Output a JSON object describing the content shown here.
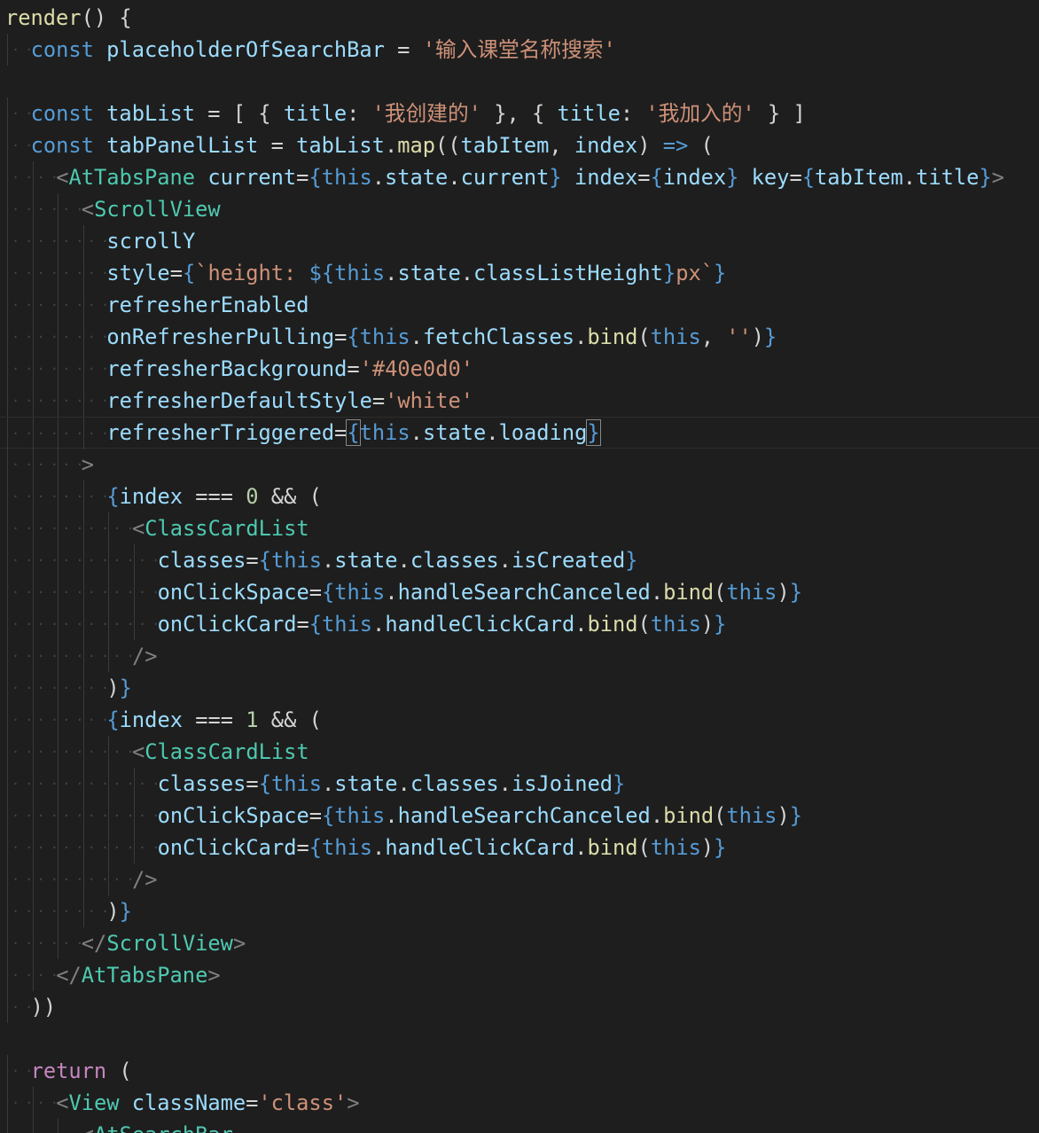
{
  "colors": {
    "background": "#1e1e1e",
    "keyword": "#569cd6",
    "variable": "#9cdcfe",
    "function": "#dcdcaa",
    "string": "#ce9178",
    "tag": "#4ec9b0",
    "number": "#b5cea8",
    "control": "#c586c0",
    "punctuation": "#d4d4d4",
    "tag_bracket": "#808080",
    "whitespace_marker": "#444444",
    "indent_guide": "#3a3a3a"
  },
  "lines": [
    {
      "indent": 0,
      "tokens": [
        [
          "render",
          "fn"
        ],
        [
          "() {",
          "p"
        ]
      ]
    },
    {
      "indent": 1,
      "tokens": [
        [
          "const",
          "kw"
        ],
        [
          " ",
          "p"
        ],
        [
          "placeholderOfSearchBar",
          "v"
        ],
        [
          " = ",
          "p"
        ],
        [
          "'输入课堂名称搜索'",
          "s"
        ]
      ]
    },
    {
      "indent": 0,
      "tokens": []
    },
    {
      "indent": 1,
      "tokens": [
        [
          "const",
          "kw"
        ],
        [
          " ",
          "p"
        ],
        [
          "tabList",
          "v"
        ],
        [
          " = [ { ",
          "p"
        ],
        [
          "title",
          "v"
        ],
        [
          ": ",
          "p"
        ],
        [
          "'我创建的'",
          "s"
        ],
        [
          " }, { ",
          "p"
        ],
        [
          "title",
          "v"
        ],
        [
          ": ",
          "p"
        ],
        [
          "'我加入的'",
          "s"
        ],
        [
          " } ]",
          "p"
        ]
      ]
    },
    {
      "indent": 1,
      "tokens": [
        [
          "const",
          "kw"
        ],
        [
          " ",
          "p"
        ],
        [
          "tabPanelList",
          "v"
        ],
        [
          " = ",
          "p"
        ],
        [
          "tabList",
          "v"
        ],
        [
          ".",
          "p"
        ],
        [
          "map",
          "fn"
        ],
        [
          "((",
          "p"
        ],
        [
          "tabItem",
          "v"
        ],
        [
          ", ",
          "p"
        ],
        [
          "index",
          "v"
        ],
        [
          ") ",
          "p"
        ],
        [
          "=>",
          "kw"
        ],
        [
          " (",
          "p"
        ]
      ]
    },
    {
      "indent": 2,
      "tokens": [
        [
          "<",
          "tb"
        ],
        [
          "AtTabsPane",
          "tag"
        ],
        [
          " ",
          "p"
        ],
        [
          "current",
          "v"
        ],
        [
          "=",
          "p"
        ],
        [
          "{",
          "kw"
        ],
        [
          "this",
          "kw"
        ],
        [
          ".",
          "p"
        ],
        [
          "state",
          "v"
        ],
        [
          ".",
          "p"
        ],
        [
          "current",
          "v"
        ],
        [
          "}",
          "kw"
        ],
        [
          " ",
          "p"
        ],
        [
          "index",
          "v"
        ],
        [
          "=",
          "p"
        ],
        [
          "{",
          "kw"
        ],
        [
          "index",
          "v"
        ],
        [
          "}",
          "kw"
        ],
        [
          " ",
          "p"
        ],
        [
          "key",
          "v"
        ],
        [
          "=",
          "p"
        ],
        [
          "{",
          "kw"
        ],
        [
          "tabItem",
          "v"
        ],
        [
          ".",
          "p"
        ],
        [
          "title",
          "v"
        ],
        [
          "}",
          "kw"
        ],
        [
          ">",
          "tb"
        ]
      ]
    },
    {
      "indent": 3,
      "tokens": [
        [
          "<",
          "tb"
        ],
        [
          "ScrollView",
          "tag"
        ]
      ]
    },
    {
      "indent": 4,
      "tokens": [
        [
          "scrollY",
          "v"
        ]
      ]
    },
    {
      "indent": 4,
      "tokens": [
        [
          "style",
          "v"
        ],
        [
          "=",
          "p"
        ],
        [
          "{",
          "kw"
        ],
        [
          "`height: ",
          "s"
        ],
        [
          "${",
          "kw"
        ],
        [
          "this",
          "kw"
        ],
        [
          ".",
          "p"
        ],
        [
          "state",
          "v"
        ],
        [
          ".",
          "p"
        ],
        [
          "classListHeight",
          "v"
        ],
        [
          "}",
          "kw"
        ],
        [
          "px`",
          "s"
        ],
        [
          "}",
          "kw"
        ]
      ]
    },
    {
      "indent": 4,
      "tokens": [
        [
          "refresherEnabled",
          "v"
        ]
      ]
    },
    {
      "indent": 4,
      "tokens": [
        [
          "onRefresherPulling",
          "v"
        ],
        [
          "=",
          "p"
        ],
        [
          "{",
          "kw"
        ],
        [
          "this",
          "kw"
        ],
        [
          ".",
          "p"
        ],
        [
          "fetchClasses",
          "v"
        ],
        [
          ".",
          "p"
        ],
        [
          "bind",
          "fn"
        ],
        [
          "(",
          "p"
        ],
        [
          "this",
          "kw"
        ],
        [
          ", ",
          "p"
        ],
        [
          "''",
          "s"
        ],
        [
          ")",
          "p"
        ],
        [
          "}",
          "kw"
        ]
      ]
    },
    {
      "indent": 4,
      "tokens": [
        [
          "refresherBackground",
          "v"
        ],
        [
          "=",
          "p"
        ],
        [
          "'#40e0d0'",
          "s"
        ]
      ]
    },
    {
      "indent": 4,
      "tokens": [
        [
          "refresherDefaultStyle",
          "v"
        ],
        [
          "=",
          "p"
        ],
        [
          "'white'",
          "s"
        ]
      ]
    },
    {
      "indent": 4,
      "current": true,
      "tokens": [
        [
          "refresherTriggered",
          "v"
        ],
        [
          "=",
          "p"
        ],
        [
          "{",
          "kw",
          "match"
        ],
        [
          "this",
          "kw"
        ],
        [
          ".",
          "p"
        ],
        [
          "state",
          "v"
        ],
        [
          ".",
          "p"
        ],
        [
          "loading",
          "v"
        ],
        [
          "}",
          "kw",
          "match"
        ]
      ]
    },
    {
      "indent": 3,
      "tokens": [
        [
          ">",
          "tb"
        ]
      ]
    },
    {
      "indent": 4,
      "tokens": [
        [
          "{",
          "kw"
        ],
        [
          "index",
          "v"
        ],
        [
          " === ",
          "p"
        ],
        [
          "0",
          "num"
        ],
        [
          " && (",
          "p"
        ]
      ]
    },
    {
      "indent": 5,
      "tokens": [
        [
          "<",
          "tb"
        ],
        [
          "ClassCardList",
          "tag"
        ]
      ]
    },
    {
      "indent": 6,
      "tokens": [
        [
          "classes",
          "v"
        ],
        [
          "=",
          "p"
        ],
        [
          "{",
          "kw"
        ],
        [
          "this",
          "kw"
        ],
        [
          ".",
          "p"
        ],
        [
          "state",
          "v"
        ],
        [
          ".",
          "p"
        ],
        [
          "classes",
          "v"
        ],
        [
          ".",
          "p"
        ],
        [
          "isCreated",
          "v"
        ],
        [
          "}",
          "kw"
        ]
      ]
    },
    {
      "indent": 6,
      "tokens": [
        [
          "onClickSpace",
          "v"
        ],
        [
          "=",
          "p"
        ],
        [
          "{",
          "kw"
        ],
        [
          "this",
          "kw"
        ],
        [
          ".",
          "p"
        ],
        [
          "handleSearchCanceled",
          "v"
        ],
        [
          ".",
          "p"
        ],
        [
          "bind",
          "fn"
        ],
        [
          "(",
          "p"
        ],
        [
          "this",
          "kw"
        ],
        [
          ")",
          "p"
        ],
        [
          "}",
          "kw"
        ]
      ]
    },
    {
      "indent": 6,
      "tokens": [
        [
          "onClickCard",
          "v"
        ],
        [
          "=",
          "p"
        ],
        [
          "{",
          "kw"
        ],
        [
          "this",
          "kw"
        ],
        [
          ".",
          "p"
        ],
        [
          "handleClickCard",
          "v"
        ],
        [
          ".",
          "p"
        ],
        [
          "bind",
          "fn"
        ],
        [
          "(",
          "p"
        ],
        [
          "this",
          "kw"
        ],
        [
          ")",
          "p"
        ],
        [
          "}",
          "kw"
        ]
      ]
    },
    {
      "indent": 5,
      "tokens": [
        [
          "/>",
          "tb"
        ]
      ]
    },
    {
      "indent": 4,
      "tokens": [
        [
          ")",
          "p"
        ],
        [
          "}",
          "kw"
        ]
      ]
    },
    {
      "indent": 4,
      "tokens": [
        [
          "{",
          "kw"
        ],
        [
          "index",
          "v"
        ],
        [
          " === ",
          "p"
        ],
        [
          "1",
          "num"
        ],
        [
          " && (",
          "p"
        ]
      ]
    },
    {
      "indent": 5,
      "tokens": [
        [
          "<",
          "tb"
        ],
        [
          "ClassCardList",
          "tag"
        ]
      ]
    },
    {
      "indent": 6,
      "tokens": [
        [
          "classes",
          "v"
        ],
        [
          "=",
          "p"
        ],
        [
          "{",
          "kw"
        ],
        [
          "this",
          "kw"
        ],
        [
          ".",
          "p"
        ],
        [
          "state",
          "v"
        ],
        [
          ".",
          "p"
        ],
        [
          "classes",
          "v"
        ],
        [
          ".",
          "p"
        ],
        [
          "isJoined",
          "v"
        ],
        [
          "}",
          "kw"
        ]
      ]
    },
    {
      "indent": 6,
      "tokens": [
        [
          "onClickSpace",
          "v"
        ],
        [
          "=",
          "p"
        ],
        [
          "{",
          "kw"
        ],
        [
          "this",
          "kw"
        ],
        [
          ".",
          "p"
        ],
        [
          "handleSearchCanceled",
          "v"
        ],
        [
          ".",
          "p"
        ],
        [
          "bind",
          "fn"
        ],
        [
          "(",
          "p"
        ],
        [
          "this",
          "kw"
        ],
        [
          ")",
          "p"
        ],
        [
          "}",
          "kw"
        ]
      ]
    },
    {
      "indent": 6,
      "tokens": [
        [
          "onClickCard",
          "v"
        ],
        [
          "=",
          "p"
        ],
        [
          "{",
          "kw"
        ],
        [
          "this",
          "kw"
        ],
        [
          ".",
          "p"
        ],
        [
          "handleClickCard",
          "v"
        ],
        [
          ".",
          "p"
        ],
        [
          "bind",
          "fn"
        ],
        [
          "(",
          "p"
        ],
        [
          "this",
          "kw"
        ],
        [
          ")",
          "p"
        ],
        [
          "}",
          "kw"
        ]
      ]
    },
    {
      "indent": 5,
      "tokens": [
        [
          "/>",
          "tb"
        ]
      ]
    },
    {
      "indent": 4,
      "tokens": [
        [
          ")",
          "p"
        ],
        [
          "}",
          "kw"
        ]
      ]
    },
    {
      "indent": 3,
      "tokens": [
        [
          "</",
          "tb"
        ],
        [
          "ScrollView",
          "tag"
        ],
        [
          ">",
          "tb"
        ]
      ]
    },
    {
      "indent": 2,
      "tokens": [
        [
          "</",
          "tb"
        ],
        [
          "AtTabsPane",
          "tag"
        ],
        [
          ">",
          "tb"
        ]
      ]
    },
    {
      "indent": 1,
      "tokens": [
        [
          "))",
          "p"
        ]
      ]
    },
    {
      "indent": 0,
      "tokens": []
    },
    {
      "indent": 1,
      "tokens": [
        [
          "return",
          "ctl"
        ],
        [
          " (",
          "p"
        ]
      ]
    },
    {
      "indent": 2,
      "tokens": [
        [
          "<",
          "tb"
        ],
        [
          "View",
          "tag"
        ],
        [
          " ",
          "p"
        ],
        [
          "className",
          "v"
        ],
        [
          "=",
          "p"
        ],
        [
          "'class'",
          "s"
        ],
        [
          ">",
          "tb"
        ]
      ]
    },
    {
      "indent": 3,
      "tokens": [
        [
          "<",
          "tb"
        ],
        [
          "AtSearchBar",
          "tag"
        ]
      ]
    }
  ]
}
